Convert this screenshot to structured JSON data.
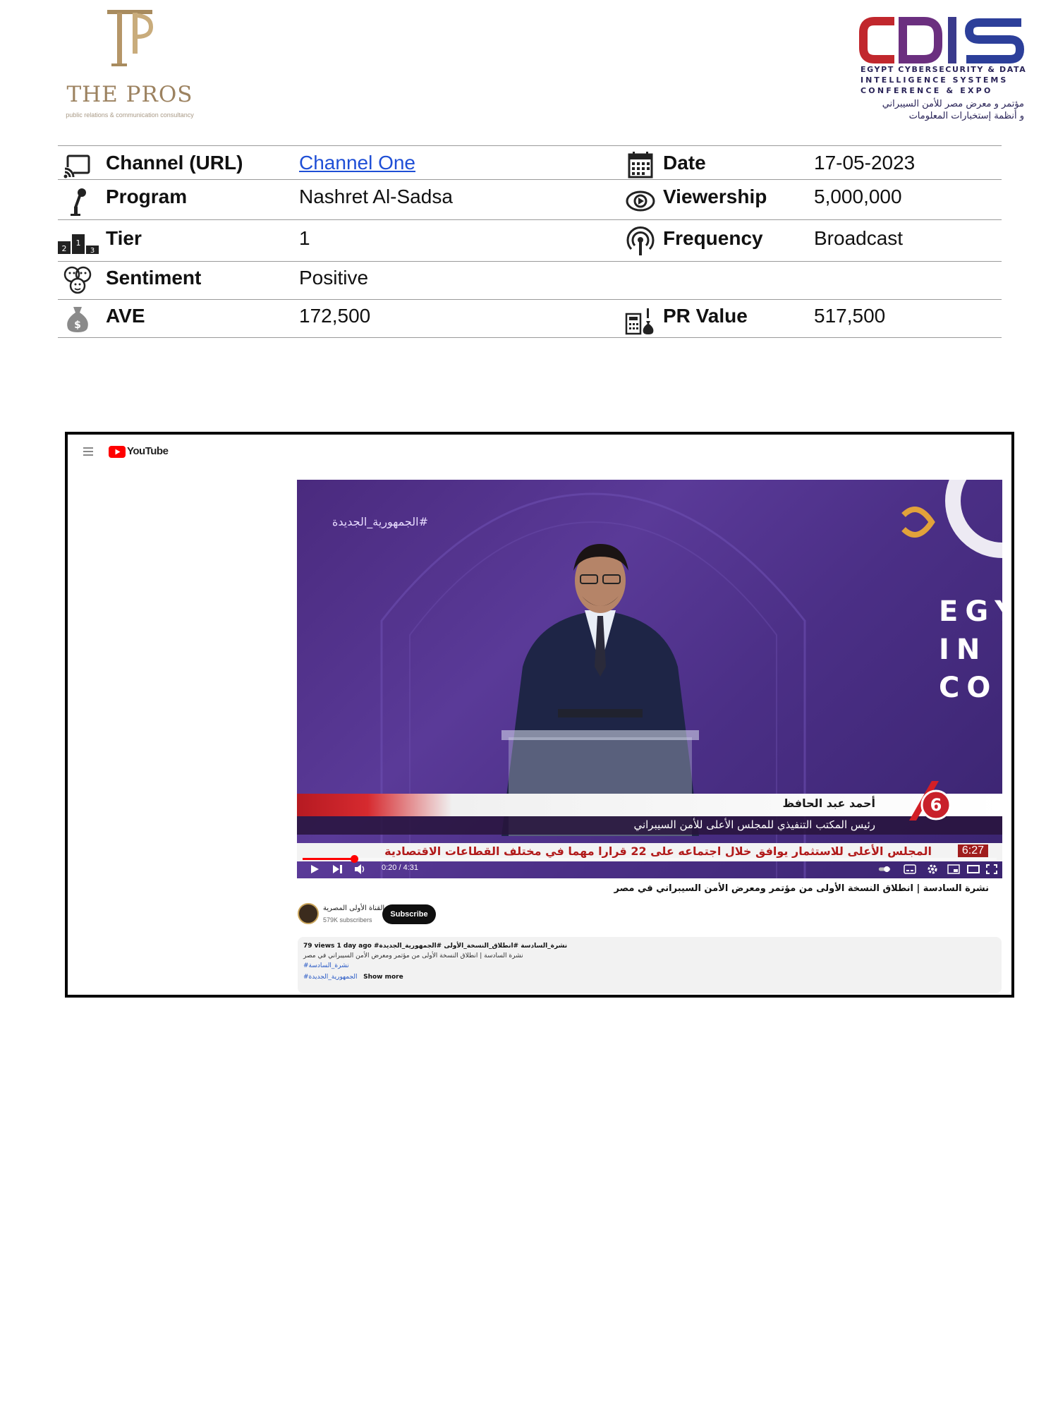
{
  "logos": {
    "pros_name": "THE PROS",
    "pros_tagline": "public relations & communication consultancy",
    "cdis_mark": "CDIS",
    "cdis_line1": "EGYPT CYBERSECURITY & DATA",
    "cdis_line2": "INTELLIGENCE SYSTEMS",
    "cdis_line3": "CONFERENCE & EXPO",
    "cdis_ar1": "مؤتمر و معرض مصر للأمن السيبراني",
    "cdis_ar2": "و أنظمة إستخبارات المعلومات"
  },
  "info": {
    "channel_label": "Channel (URL)",
    "channel_value": "Channel One",
    "date_label": "Date",
    "date_value": "17-05-2023",
    "program_label": "Program",
    "program_value": "Nashret Al-Sadsa",
    "viewership_label": "Viewership",
    "viewership_value": "5,000,000",
    "tier_label": "Tier",
    "tier_value": "1",
    "frequency_label": "Frequency",
    "frequency_value": "Broadcast",
    "sentiment_label": "Sentiment",
    "sentiment_value": "Positive",
    "ave_label": "AVE",
    "ave_value": "172,500",
    "pr_label": "PR Value",
    "pr_value": "517,500"
  },
  "youtube": {
    "logo_text": "YouTube",
    "hashtag_overlay": "#الجمهورية_الجديدة",
    "overlay_letters": "EGY IN CO",
    "lower_name": "أحمد عبد الحافظ",
    "lower_title": "رئيس المكتب التنفيذي للمجلس الأعلى للأمن السيبراني",
    "ticker": "المجلس الأعلى للاستثمار يوافق خلال اجتماعه على 22 قرارا مهما في مختلف القطاعات الاقتصادية",
    "ticker_time": "6:27",
    "time_display": "0:20 / 4:31",
    "progress": 0.074,
    "video_title": "نشرة السادسة | انطلاق النسخة الأولى من مؤتمر ومعرض الأمن السيبراني في مصر",
    "channel_name": "القناة الأولى المصرية",
    "subscribers": "579K subscribers",
    "subscribe_label": "Subscribe",
    "desc_stats": "79 views  1 day ago  #نشرة_السادسة #انطلاق_النسخة_الأولى #الجمهورية_الجديدة",
    "desc_line2": "نشرة السادسة | انطلاق النسخة الأولى من مؤتمر ومعرض الأمن السيبراني في مصر",
    "desc_tag1": "#نشرة_السادسة",
    "desc_tag2": "#الجمهورية_الجديدة",
    "show_more": "Show more"
  },
  "colors": {
    "link": "#1f4fd6",
    "pros_gold": "#9c8260",
    "cdis_red": "#c1272d",
    "cdis_navy": "#2a2458",
    "youtube_red": "#ff0000"
  }
}
